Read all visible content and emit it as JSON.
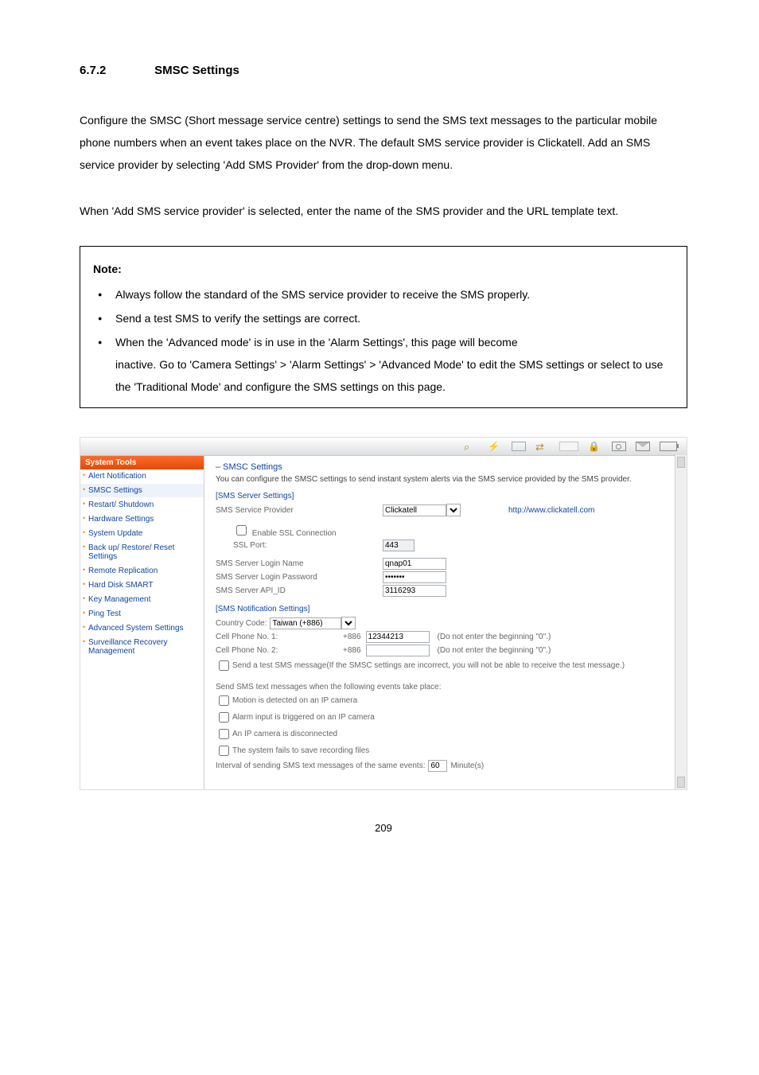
{
  "section": {
    "number": "6.7.2",
    "title": "SMSC Settings"
  },
  "para1": "Configure the SMSC (Short message service centre) settings to send the SMS text messages to the particular mobile phone numbers when an event takes place on the NVR. The default SMS service provider is Clickatell.   Add an SMS service provider by selecting 'Add SMS Provider' from the drop-down menu.",
  "para2": "When 'Add SMS service provider' is selected, enter the name of the SMS provider and the URL template text.",
  "note": {
    "heading": "Note:",
    "b1": "Always follow the standard of the SMS service provider to receive the SMS properly.",
    "b2": "Send a test SMS to verify the settings are correct.",
    "b3a": "When the 'Advanced mode' is in use in the 'Alarm Settings', this page will become",
    "b3b": "inactive.   Go to 'Camera Settings' > 'Alarm Settings' > 'Advanced Mode' to edit the SMS settings or select to use the 'Traditional Mode' and configure the SMS settings on this page."
  },
  "shot": {
    "sidebar": {
      "heading": "System Tools",
      "items": [
        "Alert Notification",
        "SMSC Settings",
        "Restart/ Shutdown",
        "Hardware Settings",
        "System Update",
        "Back up/ Restore/ Reset Settings",
        "Remote Replication",
        "Hard Disk SMART",
        "Key Management",
        "Ping Test",
        "Advanced System Settings",
        "Surveillance Recovery Management"
      ],
      "activeIndex": 1
    },
    "main": {
      "heading": "–  SMSC Settings",
      "desc": "You can configure the SMSC settings to send instant system alerts via the SMS service provided by the SMS provider.",
      "server": {
        "title": "[SMS Server Settings]",
        "providerLabel": "SMS Service Provider",
        "providerValue": "Clickatell",
        "providerLink": "http://www.clickatell.com",
        "enableSSL": "Enable SSL Connection",
        "sslPortLabel": "SSL Port:",
        "sslPortValue": "443",
        "loginNameLabel": "SMS Server Login Name",
        "loginNameValue": "qnap01",
        "loginPwLabel": "SMS Server Login Password",
        "loginPwValue": "•••••••",
        "apiLabel": "SMS Server API_ID",
        "apiValue": "3116293"
      },
      "notif": {
        "title": "[SMS Notification Settings]",
        "countryLabel": "Country Code:",
        "countryValue": "Taiwan (+886)",
        "cell1Label": "Cell Phone No. 1:",
        "cell1Prefix": "+886",
        "cell1Value": "12344213",
        "cell1Hint": "(Do not enter the beginning \"0\".)",
        "cell2Label": "Cell Phone No. 2:",
        "cell2Prefix": "+886",
        "cell2Value": "",
        "cell2Hint": "(Do not enter the beginning \"0\".)",
        "testLabelA": "Send a test SMS message ",
        "testLabelB": "(If the SMSC settings are incorrect, you will not be able to receive the test message.)"
      },
      "events": {
        "intro": "Send SMS text messages when the following events take place:",
        "e1": "Motion is detected on an IP camera",
        "e2": "Alarm input is triggered on an IP camera",
        "e3": "An IP camera is disconnected",
        "e4": "The system fails to save recording files",
        "intervalA": "Interval of sending SMS text messages of the same events: ",
        "intervalVal": "60",
        "intervalB": "Minute(s)"
      }
    }
  },
  "pageNumber": "209"
}
